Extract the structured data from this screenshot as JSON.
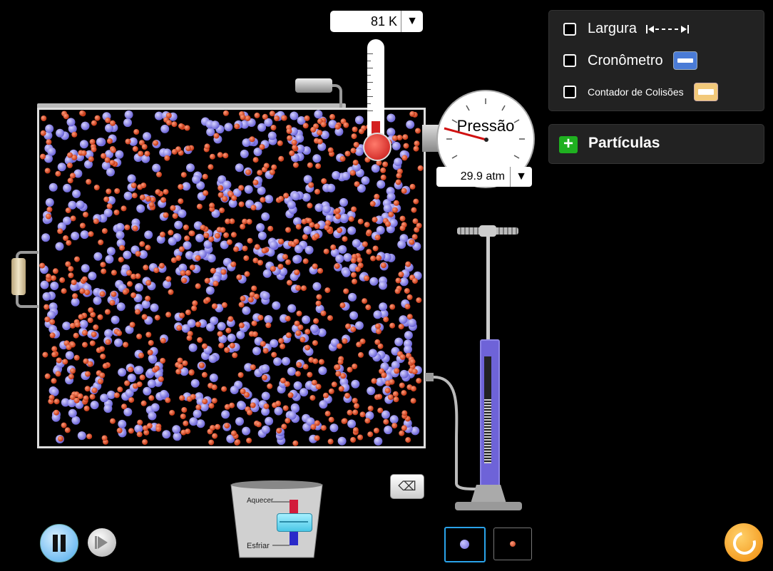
{
  "thermometer": {
    "value": "81 K",
    "dropdown": "▼"
  },
  "gauge": {
    "label": "Pressão",
    "value": "29.9 atm",
    "dropdown": "▼"
  },
  "heater": {
    "heat_label": "Aquecer",
    "cool_label": "Esfriar"
  },
  "panel": {
    "width_label": "Largura",
    "stopwatch_label": "Cronômetro",
    "collision_label": "Contador de Colisões"
  },
  "particles_panel": {
    "title": "Partículas",
    "expand_symbol": "+"
  },
  "colors": {
    "heavy": "#7f79e8",
    "light": "#e0502c",
    "accent": "#2aa3ea"
  }
}
